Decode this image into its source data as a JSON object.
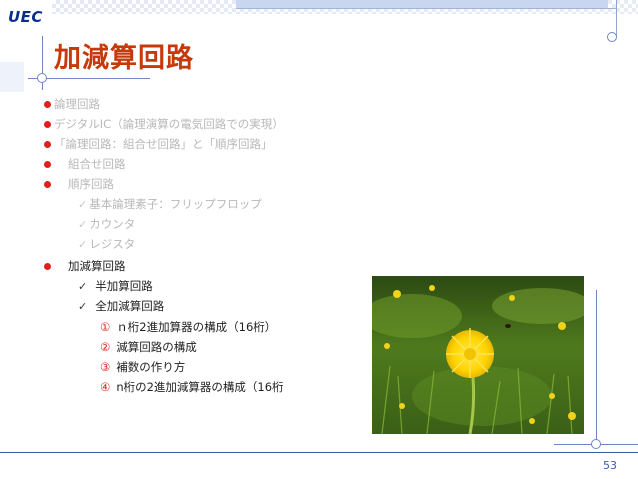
{
  "header": {
    "logo_text": "UEC",
    "title": "加減算回路"
  },
  "bullets": [
    {
      "text": "論理回路",
      "style": "faded"
    },
    {
      "text": "デジタルIC（論理演算の電気回路での実現）",
      "style": "faded"
    },
    {
      "text": "「論理回路：組合せ回路」と「順序回路」",
      "style": "faded"
    },
    {
      "text": "組合せ回路",
      "style": "faded"
    },
    {
      "text": "順序回路",
      "style": "faded"
    }
  ],
  "sequential_items": [
    "基本論理素子：フリップフロップ",
    "カウンタ",
    "レジスタ"
  ],
  "current_topic": {
    "label": "加減算回路",
    "items": [
      "半加算回路",
      "全加減算回路"
    ],
    "numbered": [
      {
        "num": "①",
        "text": "ｎ桁2進加算器の構成（16桁）"
      },
      {
        "num": "②",
        "text": "減算回路の構成"
      },
      {
        "num": "③",
        "text": "補数の作り方"
      },
      {
        "num": "④",
        "text": "n桁の2進加減算器の構成（16桁"
      }
    ]
  },
  "check_glyph": "✓",
  "footer": {
    "page_number": "53"
  },
  "colors": {
    "title": "#c63a0a",
    "bullet_dot": "#e11f1f",
    "accent_blue": "#3c5aa6",
    "faded_text": "#b8b8b8"
  }
}
